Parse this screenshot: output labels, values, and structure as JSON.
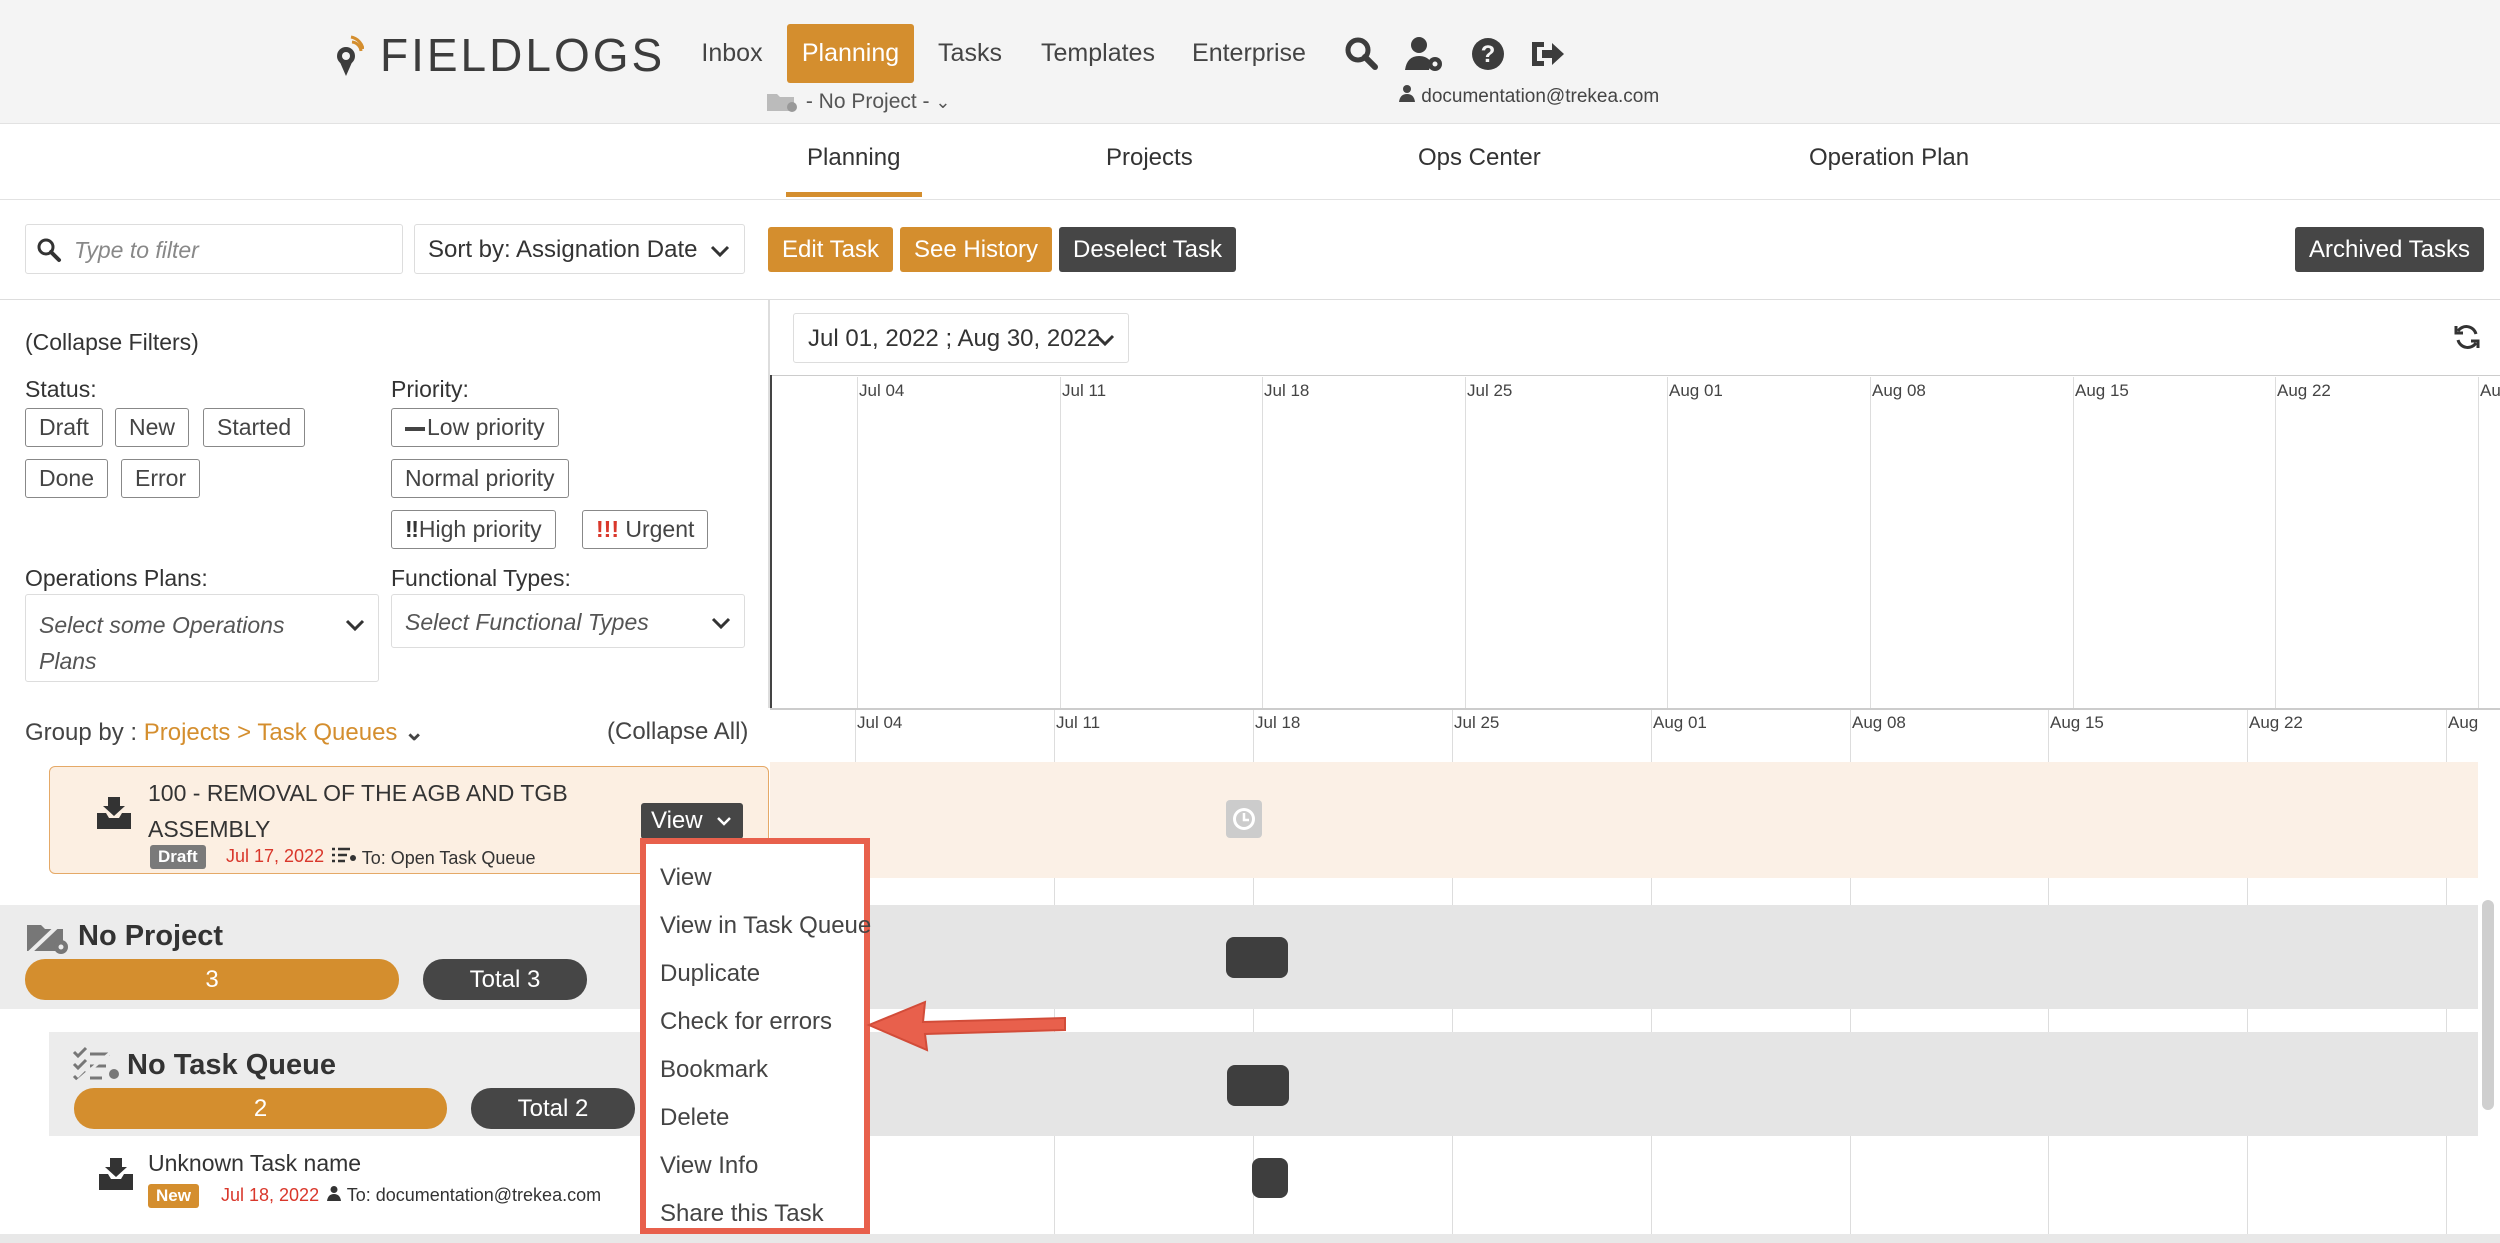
{
  "header": {
    "logo_text": "FIELDLOGS",
    "nav": [
      {
        "label": "Inbox"
      },
      {
        "label": "Planning"
      },
      {
        "label": "Tasks"
      },
      {
        "label": "Templates"
      },
      {
        "label": "Enterprise"
      }
    ],
    "project_selector": "- No Project -",
    "user_email": "documentation@trekea.com"
  },
  "tabs": [
    "Planning",
    "Projects",
    "Ops Center",
    "Operation Plan"
  ],
  "toolbar": {
    "filter_placeholder": "Type to filter",
    "sort_label": "Sort by: Assignation Date",
    "edit_task": "Edit Task",
    "see_history": "See History",
    "deselect_task": "Deselect Task",
    "archived_tasks": "Archived Tasks"
  },
  "filters": {
    "collapse": "(Collapse Filters)",
    "status_label": "Status:",
    "statuses": [
      "Draft",
      "New",
      "Started",
      "Done",
      "Error"
    ],
    "priority_label": "Priority:",
    "priorities": [
      "Low priority",
      "Normal priority",
      "High priority",
      "Urgent"
    ],
    "ops_label": "Operations Plans:",
    "ops_placeholder_1": "Select some Operations",
    "ops_placeholder_2": "Plans",
    "func_label": "Functional Types:",
    "func_placeholder": "Select Functional Types"
  },
  "timeline": {
    "date_range": "Jul 01, 2022 ; Aug 30, 2022",
    "ticks": [
      "Jul 04",
      "Jul 11",
      "Jul 18",
      "Jul 25",
      "Aug 01",
      "Aug 08",
      "Aug 15",
      "Aug 22",
      "Au"
    ],
    "ticks2": [
      "Jul 04",
      "Jul 11",
      "Jul 18",
      "Jul 25",
      "Aug 01",
      "Aug 08",
      "Aug 15",
      "Aug 22",
      "Aug"
    ]
  },
  "grouping": {
    "prefix": "Group by :",
    "value": "Projects > Task Queues",
    "collapse_all": "(Collapse All)"
  },
  "selected_task": {
    "title_1": "100 - REMOVAL OF THE AGB AND TGB",
    "title_2": "ASSEMBLY",
    "status": "Draft",
    "date": "Jul 17, 2022",
    "assignee": "To: Open Task Queue",
    "view_btn": "View"
  },
  "project": {
    "name": "No Project",
    "count": "3",
    "total": "Total 3"
  },
  "queue": {
    "name": "No Task Queue",
    "count": "2",
    "total": "Total 2"
  },
  "task2": {
    "title": "Unknown Task name",
    "status": "New",
    "date": "Jul 18, 2022",
    "assignee": "To: documentation@trekea.com"
  },
  "menu": [
    "View",
    "View in Task Queue",
    "Duplicate",
    "Check for errors",
    "Bookmark",
    "Delete",
    "View Info",
    "Share this Task"
  ],
  "colors": {
    "accent": "#d48e2e",
    "dark": "#464646",
    "highlight": "#e8604c",
    "date_red": "#d9372b"
  }
}
